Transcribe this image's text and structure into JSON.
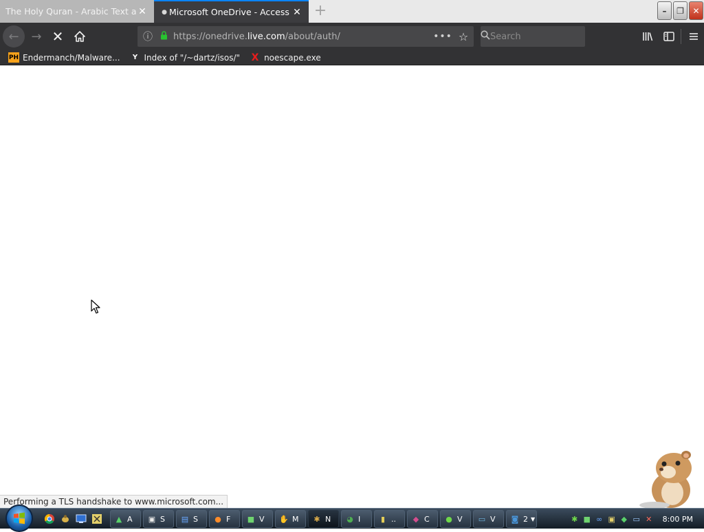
{
  "tabs": [
    {
      "title": "The Holy Quran - Arabic Text and English",
      "active": false
    },
    {
      "title": "Microsoft OneDrive - Access files",
      "active": true
    }
  ],
  "toolbar": {
    "url_prefix": "https://onedrive.",
    "url_domain": "live.com",
    "url_path": "/about/auth/",
    "search_placeholder": "Search",
    "page_actions": "•••"
  },
  "bookmarks": [
    {
      "label": "Endermanch/Malware...",
      "icon": "ph-favicon",
      "icon_text": "PH"
    },
    {
      "label": "Index of \"/~dartz/isos/\"",
      "icon": "yc-favicon",
      "icon_text": "Y"
    },
    {
      "label": "noescape.exe",
      "icon": "x-favicon",
      "icon_text": "X"
    }
  ],
  "status": {
    "text": "Performing a TLS handshake to www.microsoft.com..."
  },
  "taskbar": {
    "items": [
      {
        "icon": "triangle-app-icon",
        "label": "A",
        "color": "#5ad06a"
      },
      {
        "icon": "card-app-icon",
        "label": "S",
        "color": "#e8e8e8"
      },
      {
        "icon": "pages-app-icon",
        "label": "S",
        "color": "#6aa8ff"
      },
      {
        "icon": "firefox-app-icon",
        "label": "F",
        "color": "#ff8c2a"
      },
      {
        "icon": "green-app-icon",
        "label": "V",
        "color": "#6fd36f"
      },
      {
        "icon": "hand-app-icon",
        "label": "M",
        "color": "#d9b36c"
      },
      {
        "icon": "bug-app-icon",
        "label": "N",
        "color": "#d7a94a"
      },
      {
        "icon": "globe-app-icon",
        "label": "I",
        "color": "#4fae52"
      },
      {
        "icon": "folder-app-icon",
        "label": "..",
        "color": "#e3cd58"
      },
      {
        "icon": "disk-app-icon",
        "label": "C",
        "color": "#d54d8e"
      },
      {
        "icon": "orb-app-icon",
        "label": "V",
        "color": "#6fd84a"
      },
      {
        "icon": "monitor-app-icon",
        "label": "V",
        "color": "#6fb6e0"
      },
      {
        "icon": "group-app-icon",
        "label": "2",
        "color": "#4a95d8"
      }
    ],
    "clock": "8:00 PM"
  }
}
